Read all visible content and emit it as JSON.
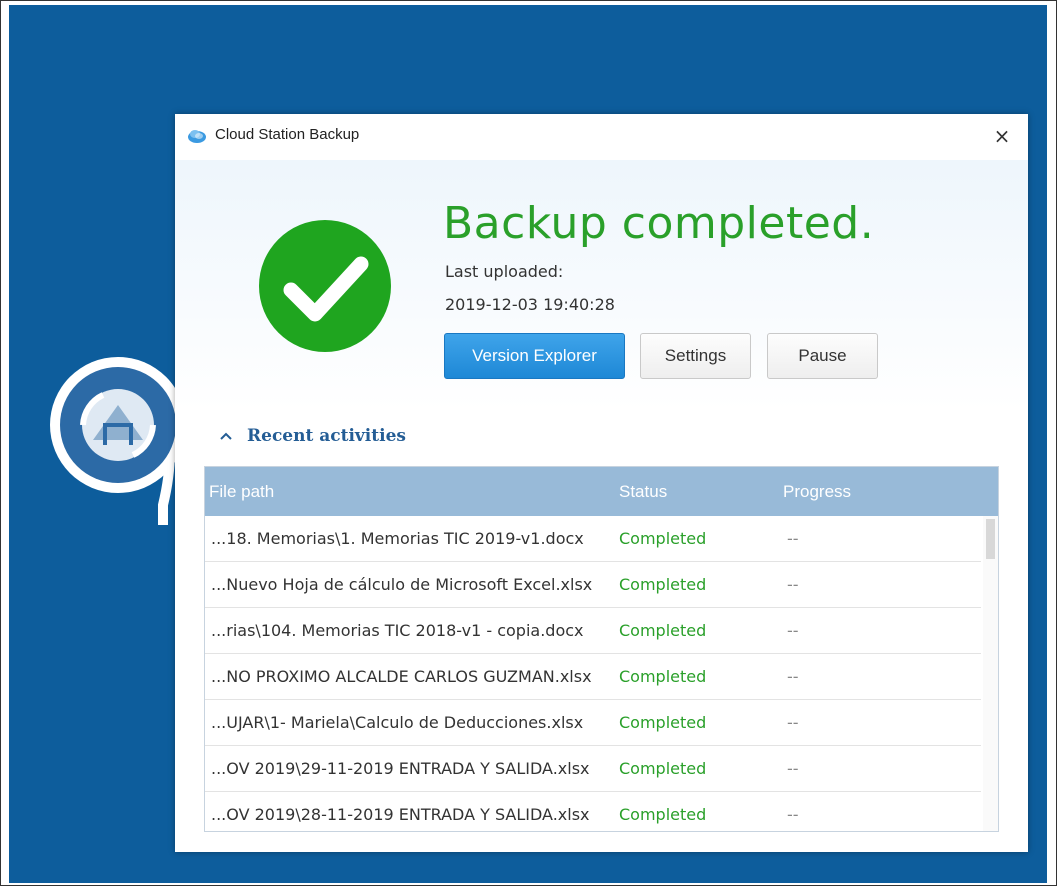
{
  "window": {
    "title": "Cloud Station Backup",
    "close_glyph": "×"
  },
  "status": {
    "headline": "Backup completed.",
    "last_uploaded_label": "Last uploaded:",
    "last_uploaded_time": "2019-12-03 19:40:28"
  },
  "buttons": {
    "version_explorer": "Version Explorer",
    "settings": "Settings",
    "pause": "Pause"
  },
  "recent": {
    "label": "Recent activities"
  },
  "table": {
    "headers": {
      "path": "File path",
      "status": "Status",
      "progress": "Progress"
    },
    "rows": [
      {
        "path": "...18. Memorias\\1. Memorias TIC 2019-v1.docx",
        "status": "Completed",
        "progress": "--"
      },
      {
        "path": "...Nuevo Hoja de cálculo de Microsoft Excel.xlsx",
        "status": "Completed",
        "progress": "--"
      },
      {
        "path": "...rias\\104. Memorias TIC 2018-v1 - copia.docx",
        "status": "Completed",
        "progress": "--"
      },
      {
        "path": "...NO PROXIMO ALCALDE CARLOS GUZMAN.xlsx",
        "status": "Completed",
        "progress": "--"
      },
      {
        "path": "...UJAR\\1- Mariela\\Calculo de Deducciones.xlsx",
        "status": "Completed",
        "progress": "--"
      },
      {
        "path": "...OV 2019\\29-11-2019 ENTRADA Y SALIDA.xlsx",
        "status": "Completed",
        "progress": "--"
      },
      {
        "path": "...OV 2019\\28-11-2019 ENTRADA Y SALIDA.xlsx",
        "status": "Completed",
        "progress": "--"
      }
    ]
  },
  "icons": {
    "app": "cloud-icon",
    "status": "checkmark-icon",
    "collapse": "chevron-up-icon",
    "close": "close-icon",
    "background_logo": "organization-logo"
  },
  "colors": {
    "desktop": "#0d5d9c",
    "success": "#2aa02a",
    "primary_button": "#1e88d6",
    "table_header": "#98bad8",
    "link": "#245d95"
  }
}
